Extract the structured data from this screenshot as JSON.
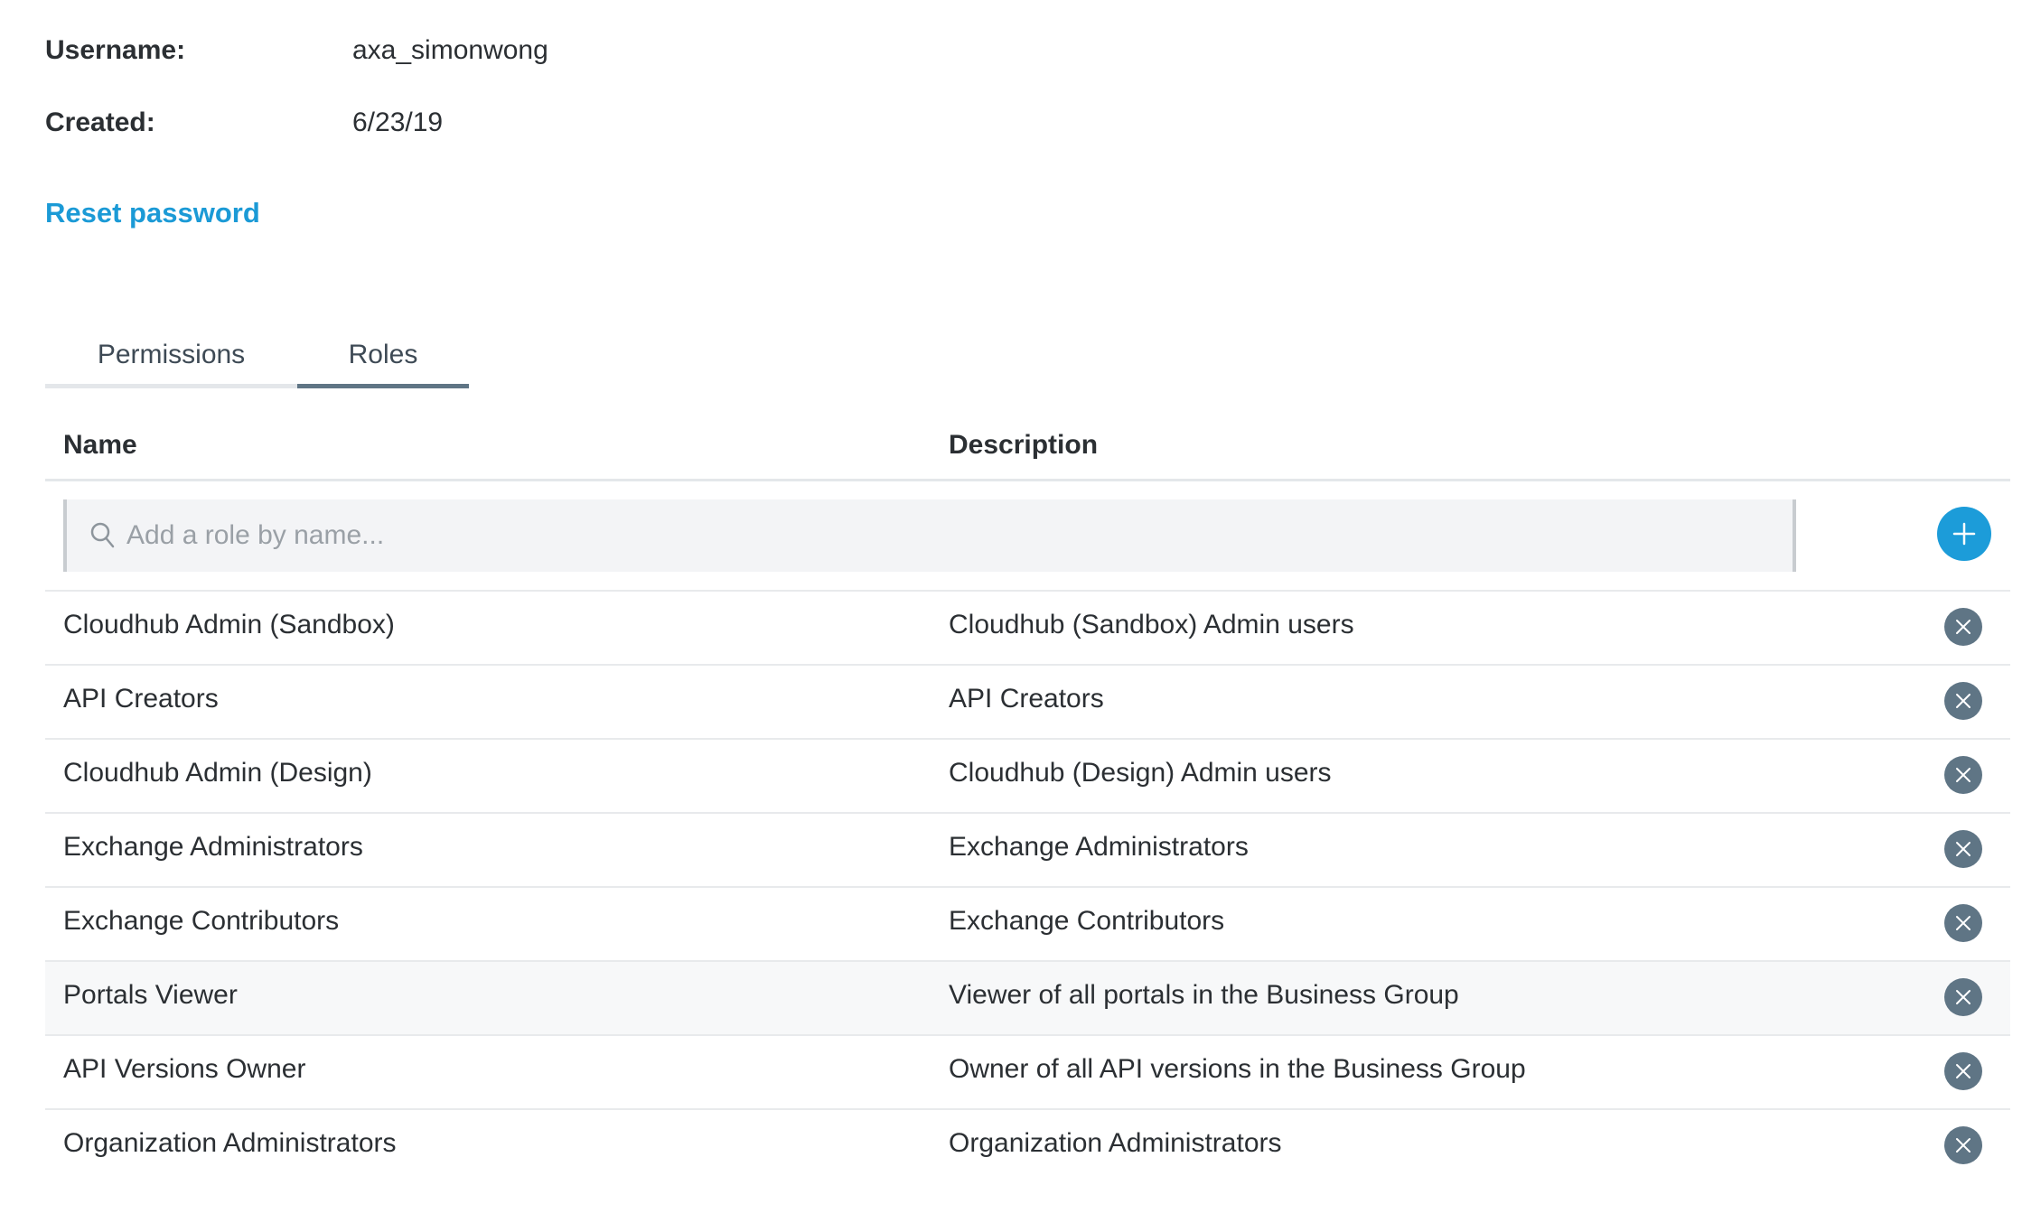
{
  "user": {
    "username_label": "Username:",
    "username_value": "axa_simonwong",
    "created_label": "Created:",
    "created_value": "6/23/19",
    "reset_password": "Reset password"
  },
  "tabs": [
    {
      "label": "Permissions",
      "active": false
    },
    {
      "label": "Roles",
      "active": true
    }
  ],
  "table": {
    "columns": [
      "Name",
      "Description"
    ],
    "search": {
      "placeholder": "Add a role by name...",
      "value": ""
    },
    "rows": [
      {
        "name": "Cloudhub Admin (Sandbox)",
        "description": "Cloudhub (Sandbox) Admin users"
      },
      {
        "name": "API Creators",
        "description": "API Creators"
      },
      {
        "name": "Cloudhub Admin (Design)",
        "description": "Cloudhub (Design) Admin users"
      },
      {
        "name": "Exchange Administrators",
        "description": "Exchange Administrators"
      },
      {
        "name": "Exchange Contributors",
        "description": "Exchange Contributors"
      },
      {
        "name": "Portals Viewer",
        "description": "Viewer of all portals in the Business Group"
      },
      {
        "name": "API Versions Owner",
        "description": "Owner of all API versions in the Business Group"
      },
      {
        "name": "Organization Administrators",
        "description": "Organization Administrators"
      }
    ]
  },
  "icons": {
    "search": "search-icon",
    "add": "plus-icon",
    "remove": "close-icon"
  },
  "colors": {
    "accent": "#1c9cd9",
    "link": "#1b9ad6",
    "remove_button": "#5f7585",
    "active_tab_underline": "#5f7585"
  }
}
